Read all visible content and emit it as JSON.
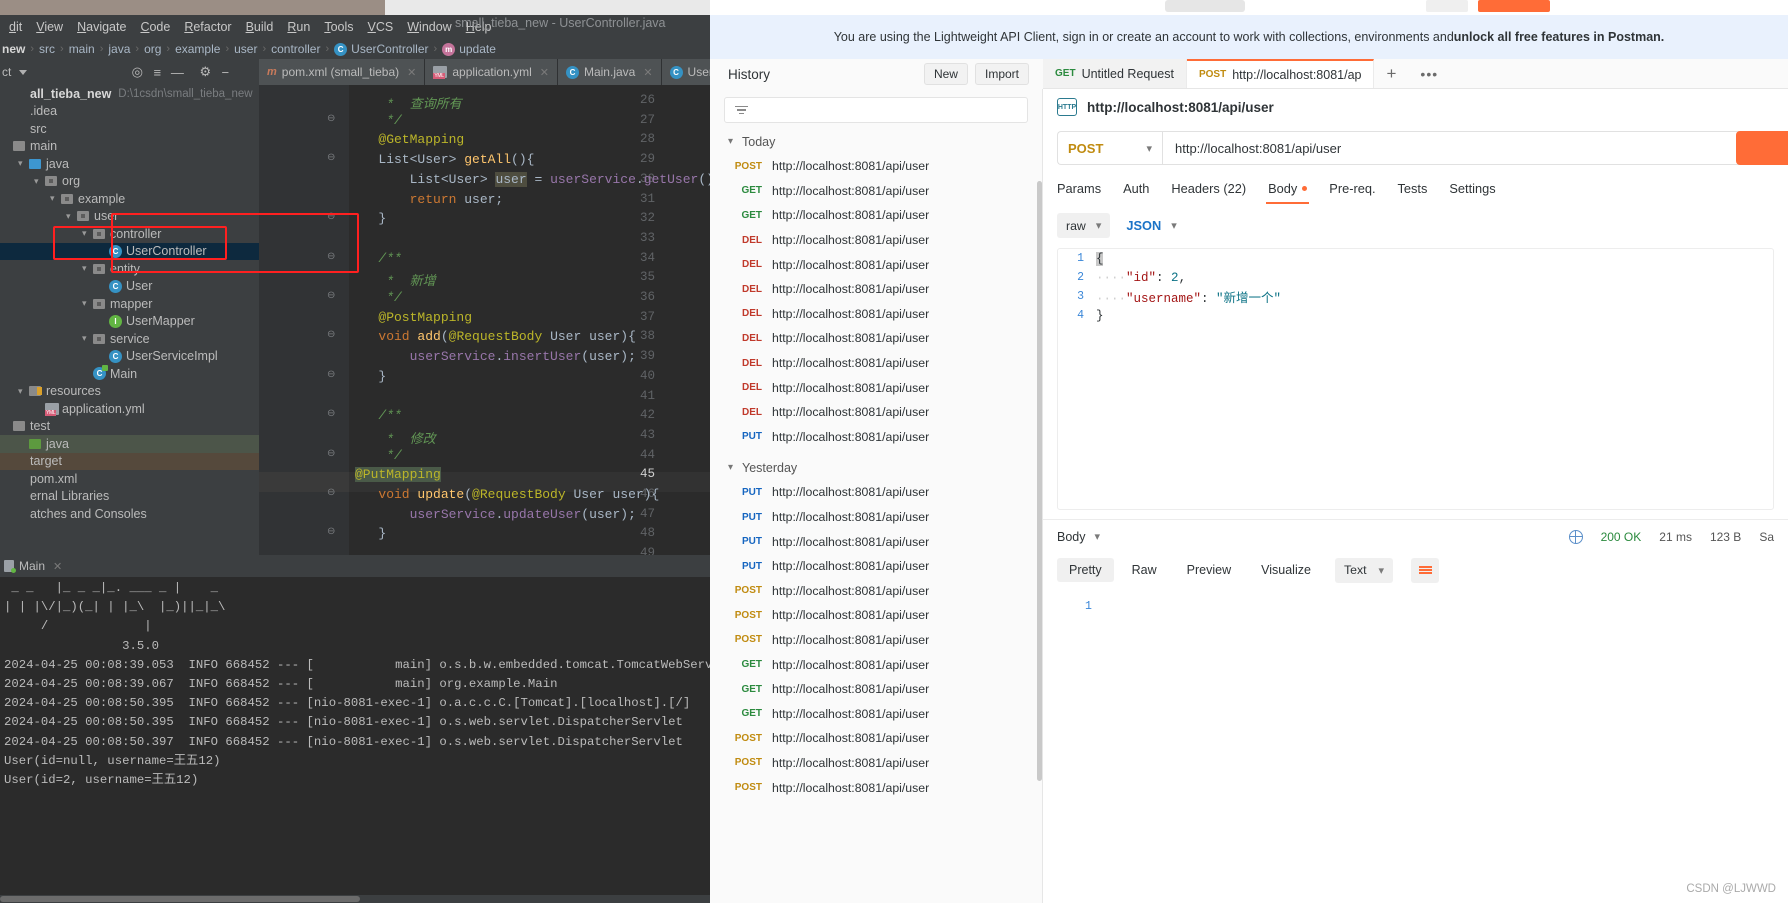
{
  "ide": {
    "window_title": "small_tieba_new - UserController.java",
    "menu": [
      "dit",
      "View",
      "Navigate",
      "Code",
      "Refactor",
      "Build",
      "Run",
      "Tools",
      "VCS",
      "Window",
      "Help"
    ],
    "breadcrumb": [
      "new",
      "src",
      "main",
      "java",
      "org",
      "example",
      "user",
      "controller",
      "UserController",
      "update"
    ],
    "breadcrumb_class_badge": "C",
    "breadcrumb_method_badge": "m",
    "project_label": "ct",
    "tabs": [
      {
        "label": "pom.xml (small_tieba)",
        "icon": "m"
      },
      {
        "label": "application.yml",
        "icon": "YML"
      },
      {
        "label": "Main.java",
        "icon": "C"
      },
      {
        "label": "User",
        "icon": "C"
      }
    ],
    "tree": [
      {
        "label": "all_tieba_new",
        "path": "D:\\1csdn\\small_tieba_new",
        "indent": 0,
        "icon": "project",
        "arrow": ""
      },
      {
        "label": ".idea",
        "indent": 0,
        "icon": "none",
        "arrow": ""
      },
      {
        "label": "src",
        "indent": 0,
        "icon": "none",
        "arrow": ""
      },
      {
        "label": "main",
        "indent": 0,
        "icon": "folder-grey",
        "arrow": ""
      },
      {
        "label": "java",
        "indent": 1,
        "icon": "folder-blue",
        "arrow": "v"
      },
      {
        "label": "org",
        "indent": 2,
        "icon": "package",
        "arrow": "v"
      },
      {
        "label": "example",
        "indent": 3,
        "icon": "package",
        "arrow": "v"
      },
      {
        "label": "user",
        "indent": 4,
        "icon": "package",
        "arrow": "v"
      },
      {
        "label": "controller",
        "indent": 5,
        "icon": "package",
        "arrow": "v"
      },
      {
        "label": "UserController",
        "indent": 6,
        "icon": "class",
        "arrow": "",
        "selected": true
      },
      {
        "label": "entity",
        "indent": 5,
        "icon": "package",
        "arrow": "v"
      },
      {
        "label": "User",
        "indent": 6,
        "icon": "class",
        "arrow": ""
      },
      {
        "label": "mapper",
        "indent": 5,
        "icon": "package",
        "arrow": "v"
      },
      {
        "label": "UserMapper",
        "indent": 6,
        "icon": "interface",
        "arrow": ""
      },
      {
        "label": "service",
        "indent": 5,
        "icon": "package",
        "arrow": "v"
      },
      {
        "label": "UserServiceImpl",
        "indent": 6,
        "icon": "class",
        "arrow": ""
      },
      {
        "label": "Main",
        "indent": 5,
        "icon": "main-class",
        "arrow": ""
      },
      {
        "label": "resources",
        "indent": 1,
        "icon": "folder-res",
        "arrow": "v"
      },
      {
        "label": "application.yml",
        "indent": 2,
        "icon": "yml",
        "arrow": ""
      },
      {
        "label": "test",
        "indent": 0,
        "icon": "folder-grey",
        "arrow": ""
      },
      {
        "label": "java",
        "indent": 1,
        "icon": "folder-green",
        "arrow": "",
        "greenrow": true
      },
      {
        "label": "target",
        "indent": 0,
        "icon": "none",
        "arrow": "",
        "brownrow": true
      },
      {
        "label": "pom.xml",
        "indent": 0,
        "icon": "none",
        "arrow": ""
      },
      {
        "label": "ernal Libraries",
        "indent": 0,
        "icon": "none",
        "arrow": ""
      },
      {
        "label": "atches and Consoles",
        "indent": 0,
        "icon": "none",
        "arrow": ""
      }
    ],
    "code_lines": [
      {
        "n": 26,
        "text": "    *  查询所有",
        "type": "comment"
      },
      {
        "n": 27,
        "text": "    */",
        "type": "comment",
        "fold": "minus-closed"
      },
      {
        "n": 28,
        "text": "   @GetMapping",
        "type": "annotation"
      },
      {
        "n": 29,
        "text": "   List<User> getAll(){",
        "type": "sig",
        "fold": "minus"
      },
      {
        "n": 30,
        "text": "       List<User> user = userService.getUser();",
        "type": "stmt"
      },
      {
        "n": 31,
        "text": "       return user;",
        "type": "ret"
      },
      {
        "n": 32,
        "text": "   }",
        "type": "plain",
        "fold": "minus-closed"
      },
      {
        "n": 33,
        "text": "",
        "type": "plain"
      },
      {
        "n": 34,
        "text": "   /**",
        "type": "comment",
        "fold": "minus"
      },
      {
        "n": 35,
        "text": "    *  新增",
        "type": "comment"
      },
      {
        "n": 36,
        "text": "    */",
        "type": "comment",
        "fold": "minus-closed"
      },
      {
        "n": 37,
        "text": "   @PostMapping",
        "type": "annotation"
      },
      {
        "n": 38,
        "text": "   void add(@RequestBody User user){",
        "type": "sig2",
        "fold": "minus"
      },
      {
        "n": 39,
        "text": "       userService.insertUser(user);",
        "type": "stmt2"
      },
      {
        "n": 40,
        "text": "   }",
        "type": "plain",
        "fold": "minus-closed"
      },
      {
        "n": 41,
        "text": "",
        "type": "plain"
      },
      {
        "n": 42,
        "text": "   /**",
        "type": "comment",
        "fold": "minus"
      },
      {
        "n": 43,
        "text": "    *  修改",
        "type": "comment"
      },
      {
        "n": 44,
        "text": "    */",
        "type": "comment",
        "fold": "minus-closed"
      },
      {
        "n": 45,
        "text": "   @PutMapping",
        "type": "annotation-hl"
      },
      {
        "n": 46,
        "text": "   void update(@RequestBody User user){",
        "type": "sig3",
        "fold": "minus"
      },
      {
        "n": 47,
        "text": "       userService.updateUser(user);",
        "type": "stmt3"
      },
      {
        "n": 48,
        "text": "   }",
        "type": "plain",
        "fold": "minus-closed"
      },
      {
        "n": 49,
        "text": "",
        "type": "plain"
      }
    ],
    "console_tab": "Main",
    "console_text": " _ _   |_ _ _|_. ___ _ |    _\n| | |\\/|_)(_| | |_\\  |_)||_|_\\\n     /             |\n                3.5.0\n2024-04-25 00:08:39.053  INFO 668452 --- [           main] o.s.b.w.embedded.tomcat.TomcatWebServer\n2024-04-25 00:08:39.067  INFO 668452 --- [           main] org.example.Main\n2024-04-25 00:08:50.395  INFO 668452 --- [nio-8081-exec-1] o.a.c.c.C.[Tomcat].[localhost].[/]\n2024-04-25 00:08:50.395  INFO 668452 --- [nio-8081-exec-1] o.s.web.servlet.DispatcherServlet\n2024-04-25 00:08:50.397  INFO 668452 --- [nio-8081-exec-1] o.s.web.servlet.DispatcherServlet\nUser(id=null, username=王五12)\nUser(id=2, username=王五12)"
  },
  "postman": {
    "banner": "You are using the Lightweight API Client, sign in or create an account to work with collections, environments and ",
    "banner_bold": "unlock all free features in Postman.",
    "history_title": "History",
    "new_label": "New",
    "import_label": "Import",
    "filter_placeholder": "",
    "tabs": [
      {
        "method": "GET",
        "label": "Untitled Request",
        "active": false
      },
      {
        "method": "POST",
        "label": "http://localhost:8081/ap",
        "active": true
      }
    ],
    "history": [
      {
        "group": "Today",
        "items": [
          {
            "method": "POST",
            "url": "http://localhost:8081/api/user"
          },
          {
            "method": "GET",
            "url": "http://localhost:8081/api/user"
          },
          {
            "method": "GET",
            "url": "http://localhost:8081/api/user"
          },
          {
            "method": "DEL",
            "url": "http://localhost:8081/api/user"
          },
          {
            "method": "DEL",
            "url": "http://localhost:8081/api/user"
          },
          {
            "method": "DEL",
            "url": "http://localhost:8081/api/user"
          },
          {
            "method": "DEL",
            "url": "http://localhost:8081/api/user"
          },
          {
            "method": "DEL",
            "url": "http://localhost:8081/api/user"
          },
          {
            "method": "DEL",
            "url": "http://localhost:8081/api/user"
          },
          {
            "method": "DEL",
            "url": "http://localhost:8081/api/user"
          },
          {
            "method": "DEL",
            "url": "http://localhost:8081/api/user"
          },
          {
            "method": "PUT",
            "url": "http://localhost:8081/api/user"
          }
        ]
      },
      {
        "group": "Yesterday",
        "items": [
          {
            "method": "PUT",
            "url": "http://localhost:8081/api/user"
          },
          {
            "method": "PUT",
            "url": "http://localhost:8081/api/user"
          },
          {
            "method": "PUT",
            "url": "http://localhost:8081/api/user"
          },
          {
            "method": "PUT",
            "url": "http://localhost:8081/api/user"
          },
          {
            "method": "POST",
            "url": "http://localhost:8081/api/user"
          },
          {
            "method": "POST",
            "url": "http://localhost:8081/api/user"
          },
          {
            "method": "POST",
            "url": "http://localhost:8081/api/user"
          },
          {
            "method": "GET",
            "url": "http://localhost:8081/api/user"
          },
          {
            "method": "GET",
            "url": "http://localhost:8081/api/user"
          },
          {
            "method": "GET",
            "url": "http://localhost:8081/api/user"
          },
          {
            "method": "POST",
            "url": "http://localhost:8081/api/user"
          },
          {
            "method": "POST",
            "url": "http://localhost:8081/api/user"
          },
          {
            "method": "POST",
            "url": "http://localhost:8081/api/user"
          }
        ]
      }
    ],
    "request": {
      "title": "http://localhost:8081/api/user",
      "method": "POST",
      "url": "http://localhost:8081/api/user",
      "tabs": [
        {
          "label": "Params",
          "active": false
        },
        {
          "label": "Auth",
          "active": false
        },
        {
          "label": "Headers (22)",
          "active": false
        },
        {
          "label": "Body",
          "active": true,
          "dot": true
        },
        {
          "label": "Pre-req.",
          "active": false
        },
        {
          "label": "Tests",
          "active": false
        },
        {
          "label": "Settings",
          "active": false
        }
      ],
      "body_mode": "raw",
      "body_format": "JSON",
      "body_lines": [
        {
          "n": 1,
          "text": "{"
        },
        {
          "n": 2,
          "text": "    \"id\": 2,"
        },
        {
          "n": 3,
          "text": "    \"username\": \"新增一个\""
        },
        {
          "n": 4,
          "text": "}"
        }
      ]
    },
    "response": {
      "body_label": "Body",
      "status": "200 OK",
      "time": "21 ms",
      "size": "123 B",
      "save_label": "Sa",
      "tabs": [
        {
          "label": "Pretty",
          "active": true
        },
        {
          "label": "Raw",
          "active": false
        },
        {
          "label": "Preview",
          "active": false
        },
        {
          "label": "Visualize",
          "active": false
        }
      ],
      "format": "Text",
      "line_number": "1",
      "content": ""
    },
    "watermark": "CSDN @LJWWD",
    "accent": "#ff6c37",
    "highlight": "#ff2020"
  }
}
